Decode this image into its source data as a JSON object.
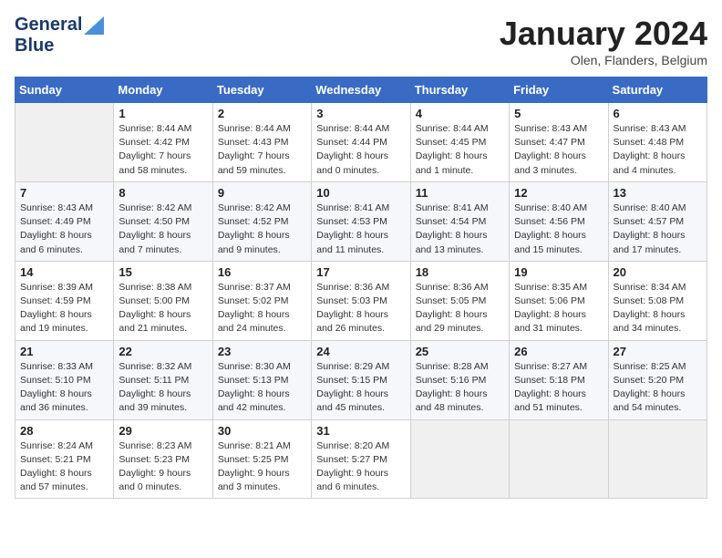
{
  "header": {
    "logo_line1": "General",
    "logo_line2": "Blue",
    "month": "January 2024",
    "location": "Olen, Flanders, Belgium"
  },
  "weekdays": [
    "Sunday",
    "Monday",
    "Tuesday",
    "Wednesday",
    "Thursday",
    "Friday",
    "Saturday"
  ],
  "weeks": [
    [
      {
        "day": "",
        "info": ""
      },
      {
        "day": "1",
        "info": "Sunrise: 8:44 AM\nSunset: 4:42 PM\nDaylight: 7 hours\nand 58 minutes."
      },
      {
        "day": "2",
        "info": "Sunrise: 8:44 AM\nSunset: 4:43 PM\nDaylight: 7 hours\nand 59 minutes."
      },
      {
        "day": "3",
        "info": "Sunrise: 8:44 AM\nSunset: 4:44 PM\nDaylight: 8 hours\nand 0 minutes."
      },
      {
        "day": "4",
        "info": "Sunrise: 8:44 AM\nSunset: 4:45 PM\nDaylight: 8 hours\nand 1 minute."
      },
      {
        "day": "5",
        "info": "Sunrise: 8:43 AM\nSunset: 4:47 PM\nDaylight: 8 hours\nand 3 minutes."
      },
      {
        "day": "6",
        "info": "Sunrise: 8:43 AM\nSunset: 4:48 PM\nDaylight: 8 hours\nand 4 minutes."
      }
    ],
    [
      {
        "day": "7",
        "info": "Sunrise: 8:43 AM\nSunset: 4:49 PM\nDaylight: 8 hours\nand 6 minutes."
      },
      {
        "day": "8",
        "info": "Sunrise: 8:42 AM\nSunset: 4:50 PM\nDaylight: 8 hours\nand 7 minutes."
      },
      {
        "day": "9",
        "info": "Sunrise: 8:42 AM\nSunset: 4:52 PM\nDaylight: 8 hours\nand 9 minutes."
      },
      {
        "day": "10",
        "info": "Sunrise: 8:41 AM\nSunset: 4:53 PM\nDaylight: 8 hours\nand 11 minutes."
      },
      {
        "day": "11",
        "info": "Sunrise: 8:41 AM\nSunset: 4:54 PM\nDaylight: 8 hours\nand 13 minutes."
      },
      {
        "day": "12",
        "info": "Sunrise: 8:40 AM\nSunset: 4:56 PM\nDaylight: 8 hours\nand 15 minutes."
      },
      {
        "day": "13",
        "info": "Sunrise: 8:40 AM\nSunset: 4:57 PM\nDaylight: 8 hours\nand 17 minutes."
      }
    ],
    [
      {
        "day": "14",
        "info": "Sunrise: 8:39 AM\nSunset: 4:59 PM\nDaylight: 8 hours\nand 19 minutes."
      },
      {
        "day": "15",
        "info": "Sunrise: 8:38 AM\nSunset: 5:00 PM\nDaylight: 8 hours\nand 21 minutes."
      },
      {
        "day": "16",
        "info": "Sunrise: 8:37 AM\nSunset: 5:02 PM\nDaylight: 8 hours\nand 24 minutes."
      },
      {
        "day": "17",
        "info": "Sunrise: 8:36 AM\nSunset: 5:03 PM\nDaylight: 8 hours\nand 26 minutes."
      },
      {
        "day": "18",
        "info": "Sunrise: 8:36 AM\nSunset: 5:05 PM\nDaylight: 8 hours\nand 29 minutes."
      },
      {
        "day": "19",
        "info": "Sunrise: 8:35 AM\nSunset: 5:06 PM\nDaylight: 8 hours\nand 31 minutes."
      },
      {
        "day": "20",
        "info": "Sunrise: 8:34 AM\nSunset: 5:08 PM\nDaylight: 8 hours\nand 34 minutes."
      }
    ],
    [
      {
        "day": "21",
        "info": "Sunrise: 8:33 AM\nSunset: 5:10 PM\nDaylight: 8 hours\nand 36 minutes."
      },
      {
        "day": "22",
        "info": "Sunrise: 8:32 AM\nSunset: 5:11 PM\nDaylight: 8 hours\nand 39 minutes."
      },
      {
        "day": "23",
        "info": "Sunrise: 8:30 AM\nSunset: 5:13 PM\nDaylight: 8 hours\nand 42 minutes."
      },
      {
        "day": "24",
        "info": "Sunrise: 8:29 AM\nSunset: 5:15 PM\nDaylight: 8 hours\nand 45 minutes."
      },
      {
        "day": "25",
        "info": "Sunrise: 8:28 AM\nSunset: 5:16 PM\nDaylight: 8 hours\nand 48 minutes."
      },
      {
        "day": "26",
        "info": "Sunrise: 8:27 AM\nSunset: 5:18 PM\nDaylight: 8 hours\nand 51 minutes."
      },
      {
        "day": "27",
        "info": "Sunrise: 8:25 AM\nSunset: 5:20 PM\nDaylight: 8 hours\nand 54 minutes."
      }
    ],
    [
      {
        "day": "28",
        "info": "Sunrise: 8:24 AM\nSunset: 5:21 PM\nDaylight: 8 hours\nand 57 minutes."
      },
      {
        "day": "29",
        "info": "Sunrise: 8:23 AM\nSunset: 5:23 PM\nDaylight: 9 hours\nand 0 minutes."
      },
      {
        "day": "30",
        "info": "Sunrise: 8:21 AM\nSunset: 5:25 PM\nDaylight: 9 hours\nand 3 minutes."
      },
      {
        "day": "31",
        "info": "Sunrise: 8:20 AM\nSunset: 5:27 PM\nDaylight: 9 hours\nand 6 minutes."
      },
      {
        "day": "",
        "info": ""
      },
      {
        "day": "",
        "info": ""
      },
      {
        "day": "",
        "info": ""
      }
    ]
  ]
}
